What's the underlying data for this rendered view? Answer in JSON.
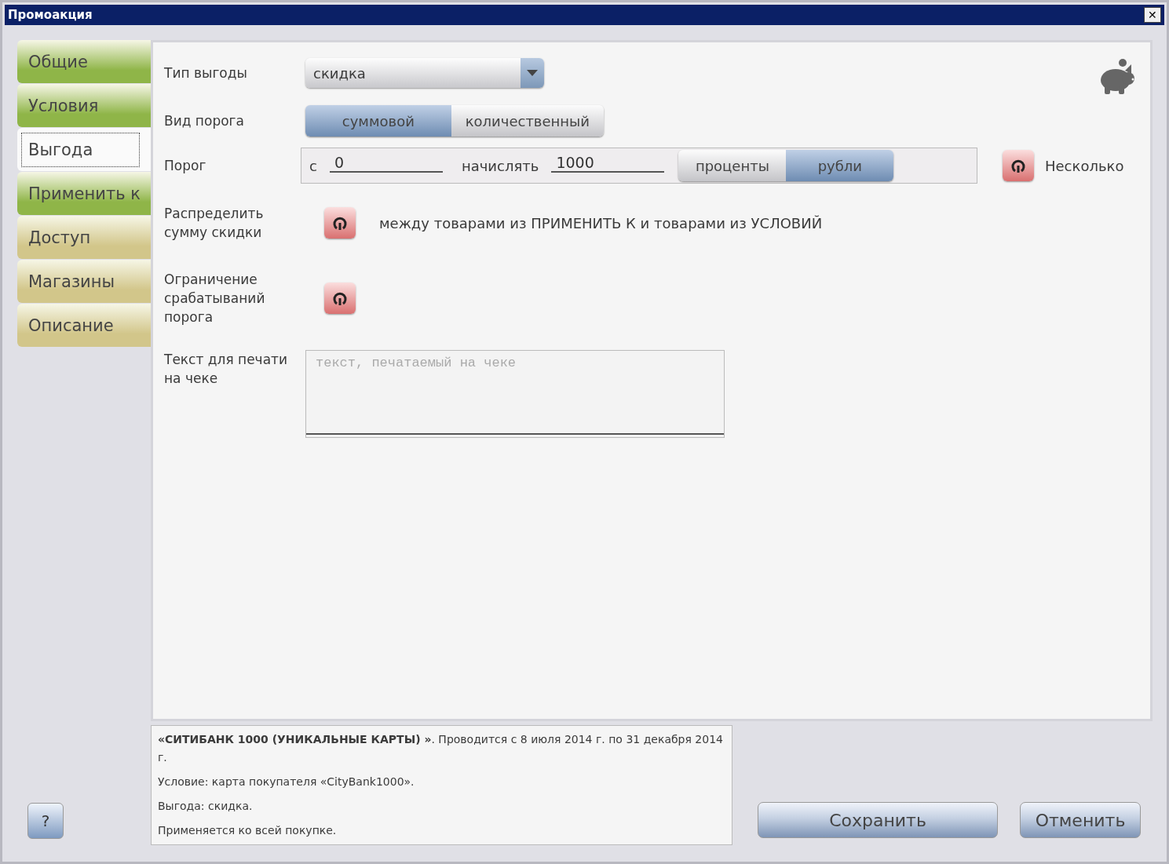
{
  "window": {
    "title": "Промоакция",
    "close": "✕"
  },
  "tabs": [
    {
      "label": "Общие",
      "selected": false,
      "color": "#8fb548"
    },
    {
      "label": "Условия",
      "selected": false,
      "color": "#8fb548"
    },
    {
      "label": "Выгода",
      "selected": true
    },
    {
      "label": "Применить к",
      "selected": false,
      "color": "#8fb548"
    },
    {
      "label": "Доступ",
      "selected": false,
      "color": "#d2c68a"
    },
    {
      "label": "Магазины",
      "selected": false,
      "color": "#d2c68a"
    },
    {
      "label": "Описание",
      "selected": false,
      "color": "#d2c68a"
    }
  ],
  "form": {
    "benefit_type": {
      "label": "Тип выгоды",
      "value": "скидка"
    },
    "threshold_kind": {
      "label": "Вид порога",
      "options": [
        {
          "label": "суммовой",
          "selected": true
        },
        {
          "label": "количественный",
          "selected": false
        }
      ]
    },
    "threshold": {
      "label": "Порог",
      "from_label": "с",
      "from_value": "0",
      "accrue_label": "начислять",
      "accrue_value": "1000",
      "units": [
        {
          "label": "проценты",
          "selected": false
        },
        {
          "label": "рубли",
          "selected": true
        }
      ],
      "multiple": {
        "label": "Несколько",
        "on": false
      }
    },
    "distribute": {
      "label": "Распределить сумму скидки",
      "on": false,
      "text": "между товарами из ПРИМЕНИТЬ К и товарами из УСЛОВИЙ"
    },
    "limit": {
      "label": "Ограничение срабатываний порога",
      "on": false
    },
    "receipt_text": {
      "label": "Текст для печати на чеке",
      "placeholder": "текст, печатаемый на чеке"
    }
  },
  "summary": [
    "**«СИТИБАНК 1000 (УНИКАЛЬНЫЕ КАРТЫ) »**. Проводится с 8 июля 2014 г. по 31 декабря 2014 г.",
    "Условие: карта покупателя «CityBank1000».",
    "Выгода: скидка.",
    "Применяется ко всей покупке."
  ],
  "help_button": "?",
  "buttons": [
    "Сохранить",
    "Отменить"
  ]
}
